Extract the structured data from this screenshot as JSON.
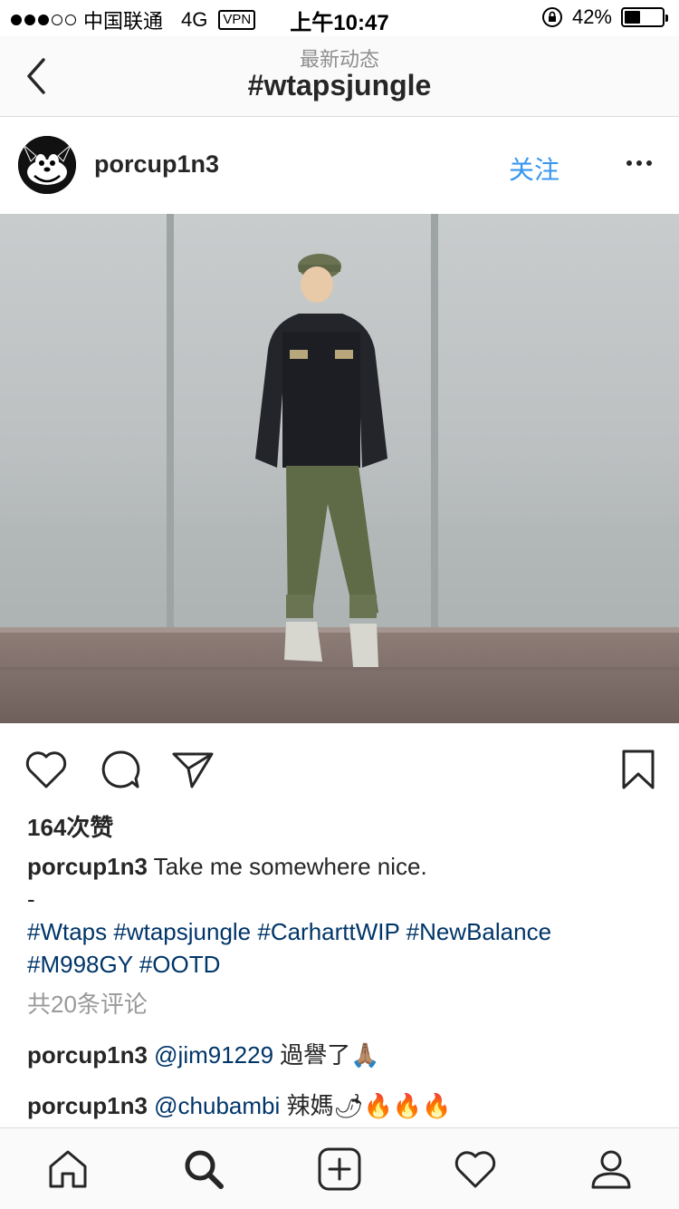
{
  "status_bar": {
    "carrier": "中国联通",
    "network": "4G",
    "vpn": "VPN",
    "time": "上午10:47",
    "battery_pct": "42%",
    "battery_level": 0.42
  },
  "nav": {
    "subtitle": "最新动态",
    "title": "#wtapsjungle"
  },
  "post": {
    "username": "porcup1n3",
    "follow_label": "关注",
    "likes": "164次赞",
    "caption_user": "porcup1n3",
    "caption_text": " Take me somewhere nice.",
    "caption_sep": "-",
    "hashtags_line1": "#Wtaps #wtapsjungle #CarharttWIP #NewBalance",
    "hashtags_line2": "#M998GY #OOTD",
    "comment_count": "共20条评论",
    "comments": [
      {
        "user": "porcup1n3",
        "mention": "@jim91229",
        "text": " 過譽了🙏🏽"
      },
      {
        "user": "porcup1n3",
        "mention": "@chubambi",
        "text": " 辣媽🌶🔥🔥🔥"
      }
    ]
  },
  "colors": {
    "follow": "#3897f0",
    "hashtag": "#003569",
    "muted": "#999999"
  }
}
